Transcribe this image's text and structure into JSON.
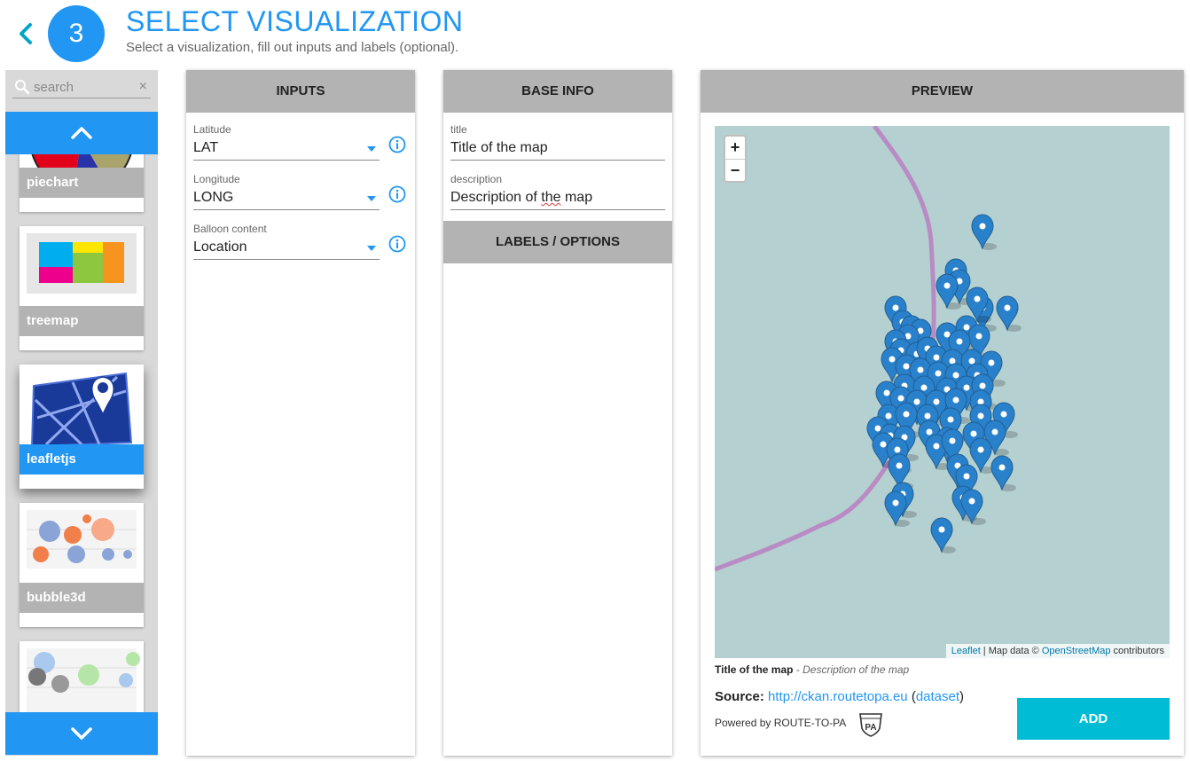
{
  "header": {
    "step": "3",
    "title": "SELECT VISUALIZATION",
    "subtitle": "Select a visualization, fill out inputs and labels (optional)."
  },
  "sidebar": {
    "search_placeholder": "search",
    "clear_symbol": "×",
    "items": [
      {
        "label": "piechart"
      },
      {
        "label": "treemap"
      },
      {
        "label": "leafletjs",
        "selected": true
      },
      {
        "label": "bubble3d"
      },
      {
        "label": ""
      }
    ]
  },
  "inputs": {
    "header": "INPUTS",
    "fields": [
      {
        "label": "Latitude",
        "value": "LAT"
      },
      {
        "label": "Longitude",
        "value": "LONG"
      },
      {
        "label": "Balloon content",
        "value": "Location"
      }
    ]
  },
  "base_info": {
    "header": "BASE INFO",
    "title_label": "title",
    "title_value": "Title of the map",
    "description_label": "description",
    "description_prefix": "Description of ",
    "description_spell": "the",
    "description_suffix": " map",
    "labels_header": "LABELS / OPTIONS"
  },
  "preview": {
    "header": "PREVIEW",
    "zoom_in": "+",
    "zoom_out": "−",
    "attribution_leaflet": "Leaflet",
    "attribution_mid": " | Map data © ",
    "attribution_osm": "OpenStreetMap",
    "attribution_end": " contributors",
    "caption_title": "Title of the map",
    "caption_sep": " - ",
    "caption_desc": "Description of the map",
    "source_label": "Source:",
    "source_url": "http://ckan.routetopa.eu",
    "source_open": " (",
    "source_link": "dataset",
    "source_close": ")",
    "powered_by": "Powered by ROUTE-TO-PA",
    "add_label": "ADD"
  },
  "colors": {
    "primary": "#2196f3",
    "add_button": "#00bcd4",
    "panel_header": "#b3b3b3",
    "map_water": "#b5d0d0",
    "map_road": "#b98bc4",
    "marker": "#2a81cb"
  }
}
